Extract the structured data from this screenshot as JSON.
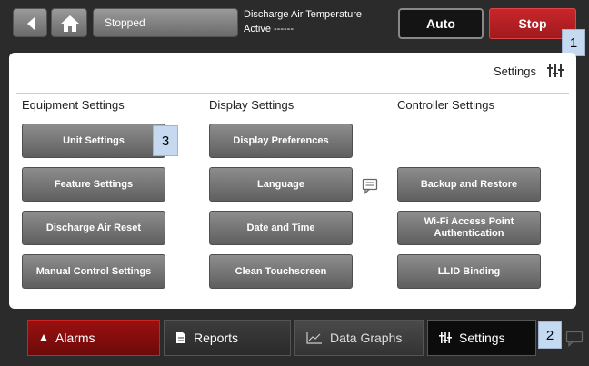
{
  "topbar": {
    "status": "Stopped",
    "active_alarm_line1": "Discharge Air Temperature",
    "active_alarm_line2": "Active ------",
    "auto_label": "Auto",
    "stop_label": "Stop"
  },
  "panel": {
    "header_label": "Settings",
    "columns": {
      "equipment": {
        "title": "Equipment Settings",
        "buttons": [
          "Unit Settings",
          "Feature Settings",
          "Discharge Air Reset",
          "Manual Control Settings"
        ]
      },
      "display": {
        "title": "Display Settings",
        "buttons": [
          "Display Preferences",
          "Language",
          "Date and Time",
          "Clean Touchscreen"
        ]
      },
      "controller": {
        "title": "Controller Settings",
        "buttons": [
          "Backup and Restore",
          "Wi-Fi Access Point Authentication",
          "LLID Binding"
        ]
      }
    }
  },
  "callouts": [
    "1",
    "2",
    "3"
  ],
  "bottombar": {
    "alarms": "Alarms",
    "reports": "Reports",
    "data_graphs": "Data Graphs",
    "settings": "Settings"
  },
  "icons": {
    "back": "back-arrow-icon",
    "home": "home-icon",
    "settings": "sliders-icon",
    "comment": "comment-icon",
    "alarm": "alarm-triangle-icon",
    "reports": "document-icon",
    "graphs": "chart-icon"
  },
  "colors": {
    "stop": "#b81f23",
    "alarms_tab": "#8a0d0d",
    "callout": "#c5d9f1"
  }
}
